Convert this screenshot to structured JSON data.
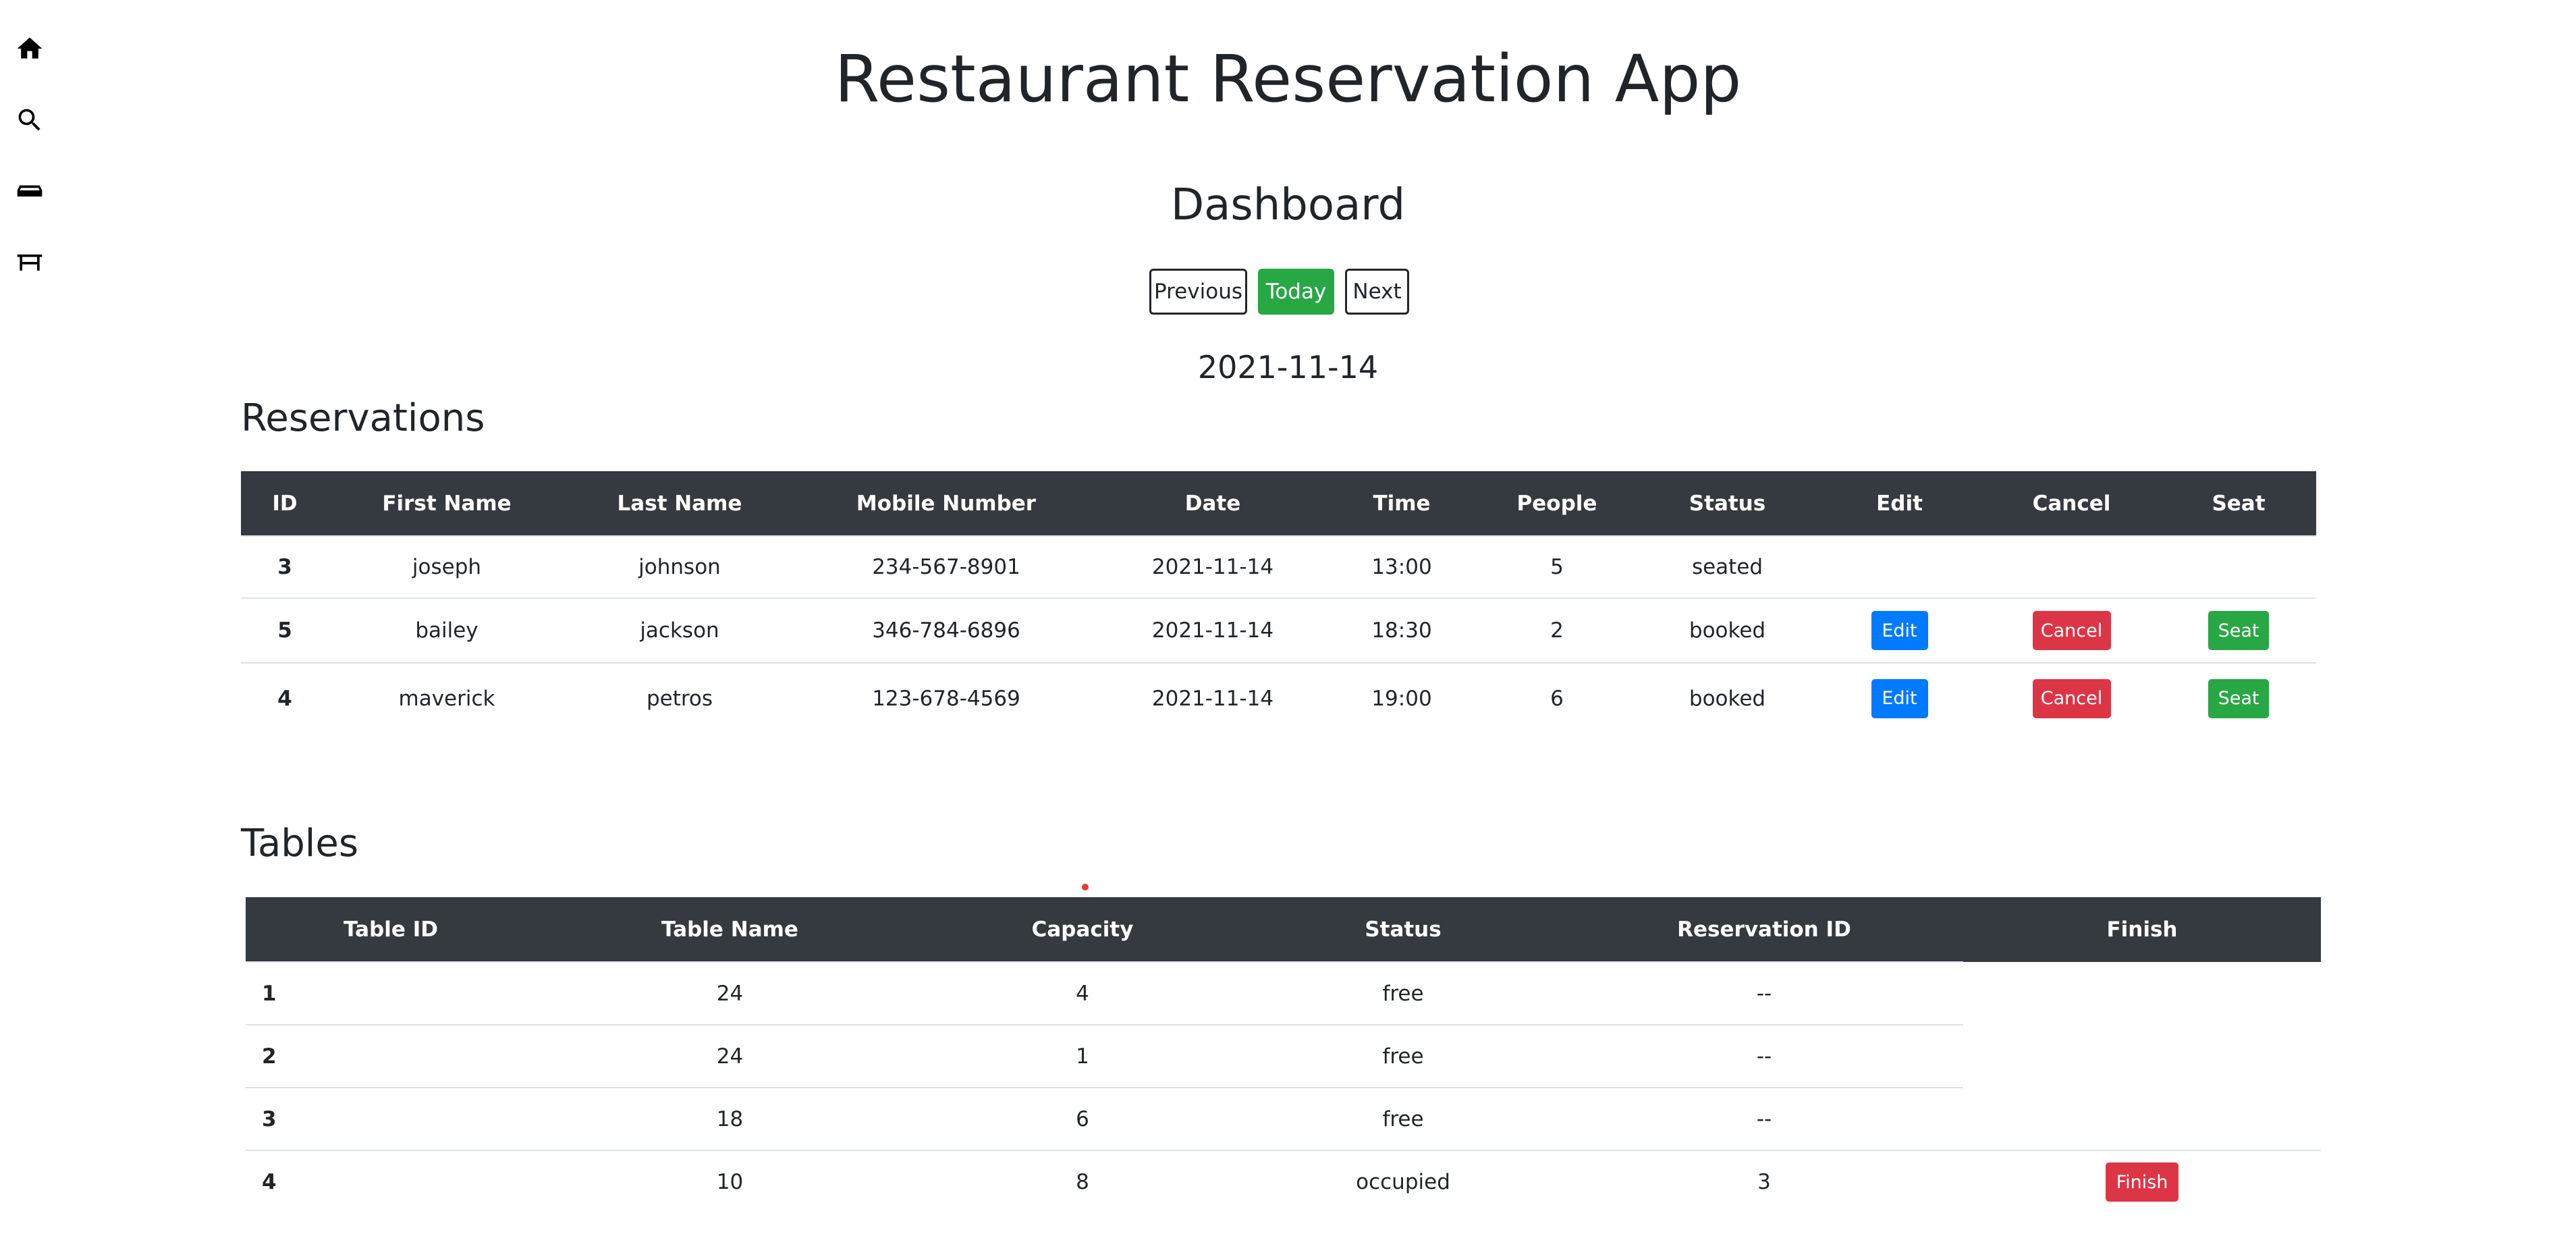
{
  "app_title": "Restaurant Reservation App",
  "dashboard_title": "Dashboard",
  "nav": {
    "previous_label": "Previous",
    "today_label": "Today",
    "next_label": "Next"
  },
  "current_date": "2021-11-14",
  "reservations": {
    "title": "Reservations",
    "headers": [
      "ID",
      "First Name",
      "Last Name",
      "Mobile Number",
      "Date",
      "Time",
      "People",
      "Status",
      "Edit",
      "Cancel",
      "Seat"
    ],
    "rows": [
      {
        "id": "3",
        "first_name": "joseph",
        "last_name": "johnson",
        "mobile": "234-567-8901",
        "date": "2021-11-14",
        "time": "13:00",
        "people": "5",
        "status": "seated"
      },
      {
        "id": "5",
        "first_name": "bailey",
        "last_name": "jackson",
        "mobile": "346-784-6896",
        "date": "2021-11-14",
        "time": "18:30",
        "people": "2",
        "status": "booked",
        "edit": "Edit",
        "cancel": "Cancel",
        "seat": "Seat"
      },
      {
        "id": "4",
        "first_name": "maverick",
        "last_name": "petros",
        "mobile": "123-678-4569",
        "date": "2021-11-14",
        "time": "19:00",
        "people": "6",
        "status": "booked",
        "edit": "Edit",
        "cancel": "Cancel",
        "seat": "Seat"
      }
    ]
  },
  "tables": {
    "title": "Tables",
    "headers": [
      "Table ID",
      "Table Name",
      "Capacity",
      "Status",
      "Reservation ID",
      "Finish"
    ],
    "rows": [
      {
        "table_id": "1",
        "table_name": "24",
        "capacity": "4",
        "status": "free",
        "reservation_id": "--"
      },
      {
        "table_id": "2",
        "table_name": "24",
        "capacity": "1",
        "status": "free",
        "reservation_id": "--"
      },
      {
        "table_id": "3",
        "table_name": "18",
        "capacity": "6",
        "status": "free",
        "reservation_id": "--"
      },
      {
        "table_id": "4",
        "table_name": "10",
        "capacity": "8",
        "status": "occupied",
        "reservation_id": "3",
        "finish": "Finish"
      }
    ]
  },
  "sidebar": {
    "icons": [
      "home-icon",
      "search-icon",
      "reservation-icon",
      "table-icon"
    ]
  },
  "colors": {
    "header_bg": "#343a40",
    "primary": "#007bff",
    "danger": "#dc3545",
    "success": "#28a745"
  }
}
